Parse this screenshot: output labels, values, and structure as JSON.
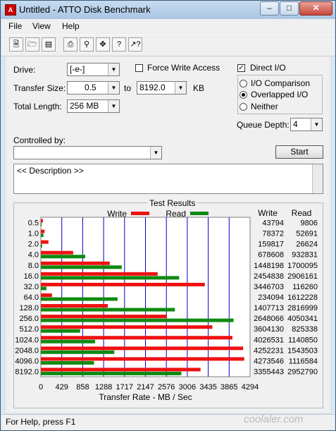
{
  "window": {
    "title": "Untitled - ATTO Disk Benchmark"
  },
  "menu": [
    "File",
    "View",
    "Help"
  ],
  "toolbar": {
    "icons": [
      "new-icon",
      "open-icon",
      "save-icon",
      "print-icon",
      "print-preview-icon",
      "move-icon",
      "help-icon",
      "context-help-icon"
    ]
  },
  "form": {
    "drive_label": "Drive:",
    "drive_value": "[-e-]",
    "force_write_label": "Force Write Access",
    "direct_io_label": "Direct I/O",
    "io_comparison_label": "I/O Comparison",
    "overlapped_io_label": "Overlapped I/O",
    "neither_label": "Neither",
    "transfer_size_label": "Transfer Size:",
    "transfer_from": "0.5",
    "to_label": "to",
    "transfer_to": "8192.0",
    "kb_label": "KB",
    "total_length_label": "Total Length:",
    "total_length_value": "256 MB",
    "queue_depth_label": "Queue Depth:",
    "queue_depth_value": "4",
    "controlled_by_label": "Controlled by:",
    "start_label": "Start",
    "description": "<< Description >>"
  },
  "results": {
    "title": "Test Results",
    "write_label": "Write",
    "read_label": "Read",
    "col_write": "Write",
    "col_read": "Read"
  },
  "chart_data": {
    "type": "bar",
    "orientation": "horizontal",
    "categories": [
      "0.5",
      "1.0",
      "2.0",
      "4.0",
      "8.0",
      "16.0",
      "32.0",
      "64.0",
      "128.0",
      "256.0",
      "512.0",
      "1024.0",
      "2048.0",
      "4096.0",
      "8192.0"
    ],
    "series": [
      {
        "name": "Write",
        "color": "#ee1111",
        "values": [
          43794,
          78372,
          159817,
          678608,
          1448198,
          2454838,
          3446703,
          234094,
          1407713,
          2648066,
          3604130,
          4026531,
          4252231,
          4273546,
          3355443
        ]
      },
      {
        "name": "Read",
        "color": "#108a10",
        "values": [
          9806,
          52691,
          26624,
          932831,
          1700095,
          2906161,
          116260,
          1612228,
          2816999,
          4050341,
          825338,
          1140850,
          1543503,
          1116584,
          2952790
        ]
      }
    ],
    "xlabel": "Transfer Rate - MB / Sec",
    "xticks": [
      "0",
      "429",
      "858",
      "1288",
      "1717",
      "2147",
      "2576",
      "3006",
      "3435",
      "3865",
      "4294"
    ],
    "xlim": [
      0,
      4294
    ]
  },
  "status": "For Help, press F1",
  "watermark": "coolaler.com"
}
